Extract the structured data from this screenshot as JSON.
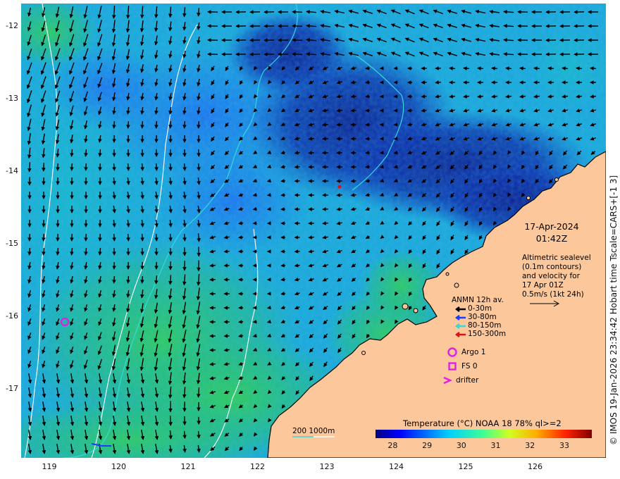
{
  "map": {
    "y_ticks": [
      "-12",
      "-13",
      "-14",
      "-15",
      "-16",
      "-17"
    ],
    "x_ticks": [
      "119",
      "120",
      "121",
      "122",
      "123",
      "124",
      "125",
      "126"
    ],
    "credit": "© IMOS 19-Jan-2026 23:34:42 Hobart time Tscale=CARS+[-1 3]",
    "date": "17-Apr-2024",
    "time": "01:42Z",
    "description_lines": [
      "Altimetric sealevel",
      "(0.1m contours)",
      "and velocity for",
      "17 Apr 01Z",
      "0.5m/s (1kt 24h)"
    ],
    "anmn": {
      "title": "ANMN 12h av.",
      "items": [
        {
          "label": "0-30m",
          "color": "#000000"
        },
        {
          "label": "30-80m",
          "color": "#1a3cff"
        },
        {
          "label": "80-150m",
          "color": "#36d8d8"
        },
        {
          "label": "150-300m",
          "color": "#e01010"
        }
      ]
    },
    "markers": [
      {
        "label": "Argo 1",
        "color": "#e020e0"
      },
      {
        "label": "FS 0",
        "color": "#e020e0"
      },
      {
        "label": "drifter",
        "color": "#e020e0"
      }
    ],
    "depth_legend": "200  1000m",
    "colorbar": {
      "title": "Temperature (°C) NOAA 18 78% ql>=2",
      "ticks": [
        "28",
        "29",
        "30",
        "31",
        "32",
        "33"
      ],
      "range": [
        27.5,
        33.8
      ]
    },
    "colors": {
      "land": "#fbc79b",
      "coast": "#000000",
      "contour200": "#36d8d8",
      "contour1000": "#ffffff"
    }
  }
}
